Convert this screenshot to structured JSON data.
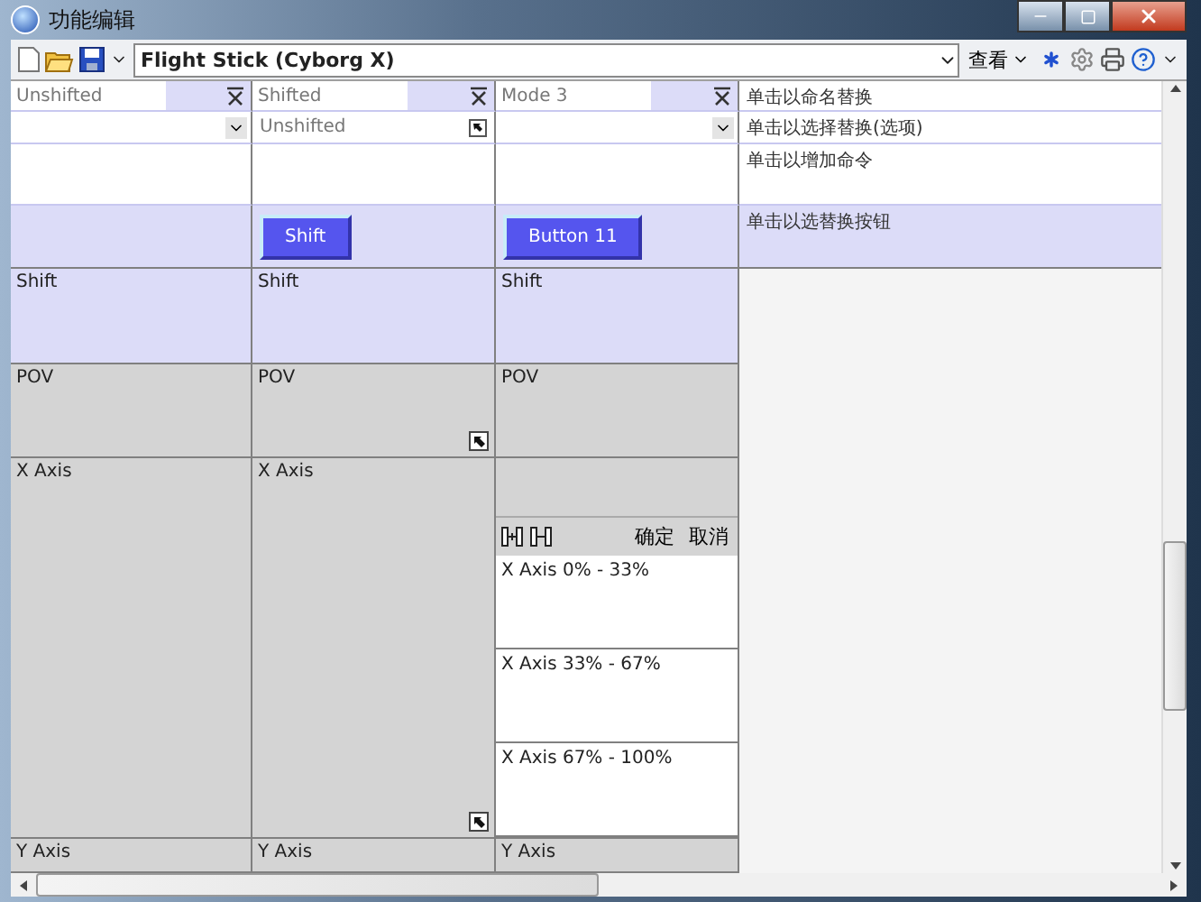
{
  "window": {
    "title": "功能编辑"
  },
  "toolbar": {
    "profile": "Flight Stick (Cyborg X)",
    "view_menu": "查看"
  },
  "columns": [
    {
      "name": "Unshifted",
      "selector": {
        "kind": "dropdown"
      },
      "cells": [
        {
          "kind": "plain",
          "label": "Shift",
          "corner_button": false
        },
        {
          "kind": "plain",
          "label": "POV",
          "corner_button": false
        },
        {
          "kind": "plain",
          "label": "X Axis",
          "corner_button": false
        },
        {
          "kind": "plain",
          "label": "Y Axis",
          "corner_button": false
        }
      ]
    },
    {
      "name": "Shifted",
      "selector": {
        "kind": "link",
        "value": "Unshifted"
      },
      "button": "Shift",
      "cells": [
        {
          "kind": "plain",
          "label": "Shift",
          "corner_button": false
        },
        {
          "kind": "plain",
          "label": "POV",
          "corner_button": true
        },
        {
          "kind": "plain",
          "label": "X Axis",
          "corner_button": true
        },
        {
          "kind": "plain",
          "label": "Y Axis",
          "corner_button": false
        }
      ]
    },
    {
      "name": "Mode 3",
      "selector": {
        "kind": "dropdown"
      },
      "button": "Button 11",
      "cells": [
        {
          "kind": "plain",
          "label": "Shift",
          "corner_button": false
        },
        {
          "kind": "plain",
          "label": "POV",
          "corner_button": false
        },
        {
          "kind": "split",
          "actions": [
            "确定",
            "取消"
          ],
          "bands": [
            "X Axis 0% - 33%",
            "X Axis 33% - 67%",
            "X Axis 67% - 100%"
          ]
        },
        {
          "kind": "plain",
          "label": "Y Axis",
          "corner_button": false
        }
      ]
    }
  ],
  "hints": [
    "单击以命名替换",
    "单击以选择替换(选项)",
    "单击以增加命令",
    "单击以选替换按钮"
  ]
}
